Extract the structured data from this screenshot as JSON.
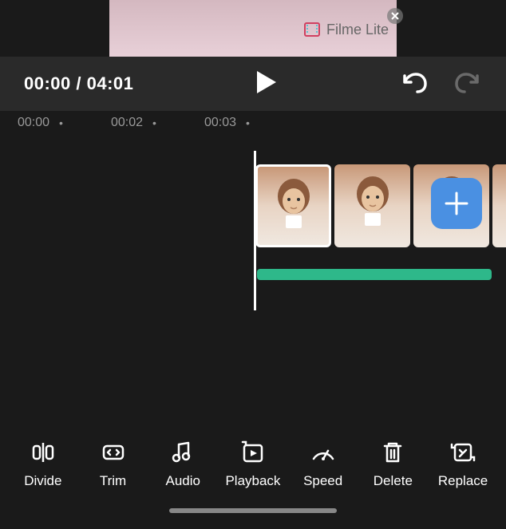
{
  "watermark": {
    "label": "Filme Lite"
  },
  "playback": {
    "current_time": "00:00",
    "total_time": "04:01",
    "separator": " / "
  },
  "ruler": {
    "marks": [
      "00:00",
      "00:02",
      "00:03"
    ]
  },
  "tools": [
    {
      "name": "divide",
      "label": "Divide"
    },
    {
      "name": "trim",
      "label": "Trim"
    },
    {
      "name": "audio",
      "label": "Audio"
    },
    {
      "name": "playback",
      "label": "Playback"
    },
    {
      "name": "speed",
      "label": "Speed"
    },
    {
      "name": "delete",
      "label": "Delete"
    },
    {
      "name": "replace",
      "label": "Replace"
    }
  ],
  "colors": {
    "accent": "#4a90e2",
    "audio_track": "#2eb88a"
  }
}
